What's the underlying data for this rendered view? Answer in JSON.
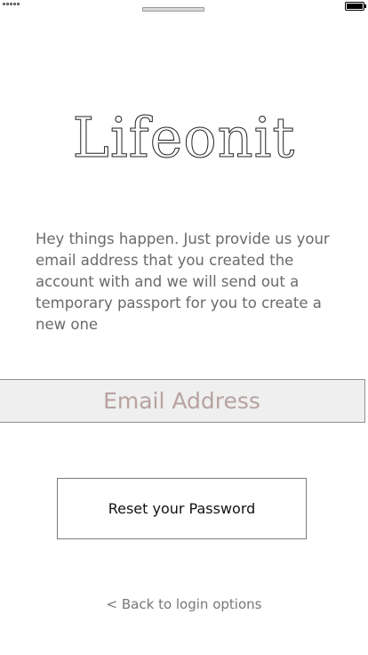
{
  "status_bar": {
    "signal_icon": "signal-dots-icon",
    "battery_icon": "battery-icon"
  },
  "logo": {
    "text": "Lifeonit"
  },
  "description": "Hey things happen. Just provide us your email address that you created the account with and we will send out a temporary passport for you to create a new one",
  "email_field": {
    "placeholder": "Email Address",
    "value": ""
  },
  "reset_button": {
    "label": "Reset your Password"
  },
  "back_link": {
    "label": "< Back to login options"
  },
  "colors": {
    "placeholder": "#b8a2a2",
    "field_background": "#efefef",
    "body_text": "#6a6a6a"
  }
}
